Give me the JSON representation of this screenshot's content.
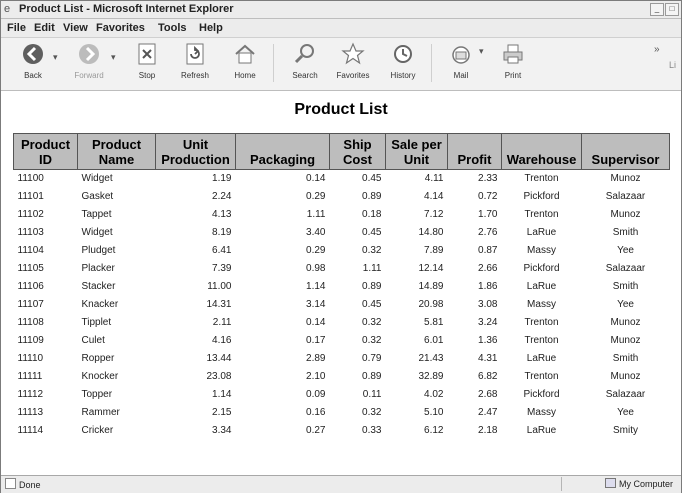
{
  "window": {
    "title": "Product List - Microsoft Internet Explorer"
  },
  "menu": [
    "File",
    "Edit",
    "View",
    "Favorites",
    "Tools",
    "Help"
  ],
  "toolbar": {
    "back": "Back",
    "forward": "Forward",
    "stop": "Stop",
    "refresh": "Refresh",
    "home": "Home",
    "search": "Search",
    "favorites": "Favorites",
    "history": "History",
    "mail": "Mail",
    "print": "Print",
    "overflow": "Li"
  },
  "page": {
    "title": "Product List",
    "headers": [
      "Product ID",
      "Product Name",
      "Unit Production",
      "Packaging",
      "Ship Cost",
      "Sale per Unit",
      "Profit",
      "Warehouse",
      "Supervisor"
    ],
    "rows": [
      [
        "11100",
        "Widget",
        "1.19",
        "0.14",
        "0.45",
        "4.11",
        "2.33",
        "Trenton",
        "Munoz"
      ],
      [
        "11101",
        "Gasket",
        "2.24",
        "0.29",
        "0.89",
        "4.14",
        "0.72",
        "Pickford",
        "Salazaar"
      ],
      [
        "11102",
        "Tappet",
        "4.13",
        "1.11",
        "0.18",
        "7.12",
        "1.70",
        "Trenton",
        "Munoz"
      ],
      [
        "11103",
        "Widget",
        "8.19",
        "3.40",
        "0.45",
        "14.80",
        "2.76",
        "LaRue",
        "Smith"
      ],
      [
        "11104",
        "Pludget",
        "6.41",
        "0.29",
        "0.32",
        "7.89",
        "0.87",
        "Massy",
        "Yee"
      ],
      [
        "11105",
        "Placker",
        "7.39",
        "0.98",
        "1.11",
        "12.14",
        "2.66",
        "Pickford",
        "Salazaar"
      ],
      [
        "11106",
        "Stacker",
        "11.00",
        "1.14",
        "0.89",
        "14.89",
        "1.86",
        "LaRue",
        "Smith"
      ],
      [
        "11107",
        "Knacker",
        "14.31",
        "3.14",
        "0.45",
        "20.98",
        "3.08",
        "Massy",
        "Yee"
      ],
      [
        "11108",
        "Tipplet",
        "2.11",
        "0.14",
        "0.32",
        "5.81",
        "3.24",
        "Trenton",
        "Munoz"
      ],
      [
        "11109",
        "Culet",
        "4.16",
        "0.17",
        "0.32",
        "6.01",
        "1.36",
        "Trenton",
        "Munoz"
      ],
      [
        "11110",
        "Ropper",
        "13.44",
        "2.89",
        "0.79",
        "21.43",
        "4.31",
        "LaRue",
        "Smith"
      ],
      [
        "11111",
        "Knocker",
        "23.08",
        "2.10",
        "0.89",
        "32.89",
        "6.82",
        "Trenton",
        "Munoz"
      ],
      [
        "11112",
        "Topper",
        "1.14",
        "0.09",
        "0.11",
        "4.02",
        "2.68",
        "Pickford",
        "Salazaar"
      ],
      [
        "11113",
        "Rammer",
        "2.15",
        "0.16",
        "0.32",
        "5.10",
        "2.47",
        "Massy",
        "Yee"
      ],
      [
        "11114",
        "Cricker",
        "3.34",
        "0.27",
        "0.33",
        "6.12",
        "2.18",
        "LaRue",
        "Smity"
      ]
    ]
  },
  "status": {
    "left": "Done",
    "right": "My Computer"
  },
  "colors": {
    "header_bg": "#bdbdbd",
    "chrome_bg": "#ececec"
  },
  "icons": {
    "back": "back-arrow-icon",
    "forward": "forward-arrow-icon",
    "stop": "stop-icon",
    "refresh": "refresh-icon",
    "home": "home-icon",
    "search": "search-icon",
    "favorites": "star-icon",
    "history": "history-icon",
    "mail": "mail-icon",
    "print": "print-icon"
  }
}
